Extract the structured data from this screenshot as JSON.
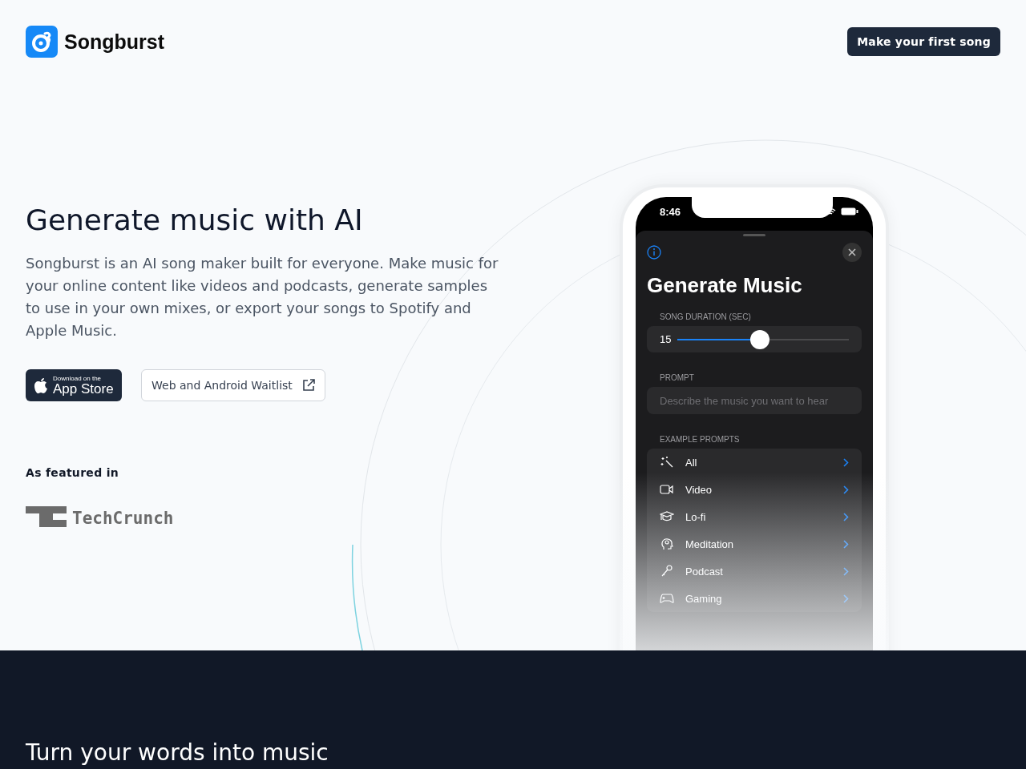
{
  "brand": {
    "name": "Songburst"
  },
  "header": {
    "cta": "Make your first song"
  },
  "hero": {
    "title": "Generate music with AI",
    "description": "Songburst is an AI song maker built for everyone. Make music for your online content like videos and podcasts, generate samples to use in your own mixes, or export your songs to Spotify and Apple Music.",
    "app_store": {
      "small": "Download on the",
      "large": "App Store"
    },
    "waitlist": "Web and Android Waitlist",
    "featured_label": "As featured in",
    "featured_logo": "TechCrunch"
  },
  "phone": {
    "time": "8:46",
    "title": "Generate Music",
    "duration_label": "SONG DURATION (SEC)",
    "duration_value": "15",
    "level": 0.48,
    "prompt_label": "PROMPT",
    "prompt_placeholder": "Describe the music you want to hear",
    "examples_label": "EXAMPLE PROMPTS",
    "examples": [
      {
        "kind": "wand",
        "label": "All"
      },
      {
        "kind": "video",
        "label": "Video"
      },
      {
        "kind": "cap",
        "label": "Lo-fi"
      },
      {
        "kind": "head",
        "label": "Meditation"
      },
      {
        "kind": "mic",
        "label": "Podcast"
      },
      {
        "kind": "gamepad",
        "label": "Gaming"
      }
    ]
  },
  "next_section": {
    "title": "Turn your words into music"
  }
}
